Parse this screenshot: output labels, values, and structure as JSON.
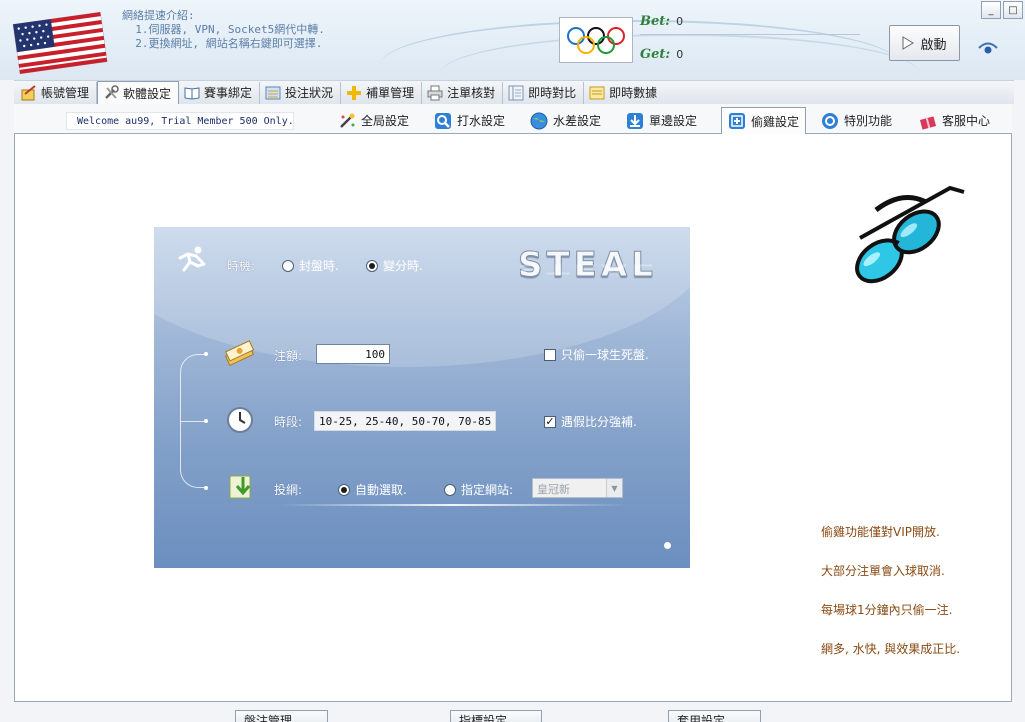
{
  "header": {
    "intro_lines": [
      "網絡提速介紹:",
      "  1.伺服器, VPN, Socket5網代中轉.",
      "  2.更換網址, 網站名稱右鍵即可選擇."
    ],
    "bet_label": "Bet:",
    "bet_value": "0",
    "get_label": "Get:",
    "get_value": "0",
    "start_label": "啟動",
    "minimize_label": "_",
    "close_label": "□"
  },
  "main_tabs": [
    {
      "label": "帳號管理",
      "icon": "account-icon"
    },
    {
      "label": "軟體設定",
      "icon": "tools-icon"
    },
    {
      "label": "賽事綁定",
      "icon": "book-icon"
    },
    {
      "label": "投注狀況",
      "icon": "list-icon"
    },
    {
      "label": "補單管理",
      "icon": "plus-icon"
    },
    {
      "label": "注單核對",
      "icon": "printer-icon"
    },
    {
      "label": "即時對比",
      "icon": "compare-icon"
    },
    {
      "label": "即時數據",
      "icon": "data-icon"
    }
  ],
  "welcome": "Welcome au99, Trial Member 500 Only.",
  "sub_tabs": [
    {
      "label": "全局設定",
      "icon": "wand-icon"
    },
    {
      "label": "打水設定",
      "icon": "magnifier-icon"
    },
    {
      "label": "水差設定",
      "icon": "globe-icon"
    },
    {
      "label": "單邊設定",
      "icon": "download-icon"
    },
    {
      "label": "偷雞設定",
      "icon": "plus-box-icon"
    },
    {
      "label": "特別功能",
      "icon": "target-icon"
    },
    {
      "label": "客服中心",
      "icon": "gift-icon"
    }
  ],
  "steal": {
    "logo": "STEAL",
    "timing_label": "時機:",
    "timing_opt1": "封盤時.",
    "timing_opt2": "變分時.",
    "amount_label": "注額:",
    "amount_value": "100",
    "period_label": "時段:",
    "period_value": "10-25, 25-40, 50-70, 70-85",
    "site_label": "投網:",
    "auto_label": "自動選取.",
    "specify_label": "指定網站:",
    "site_select": "皇冠新",
    "chk1_label": "只偷一球生死盤.",
    "chk1_checked": false,
    "chk2_label": "遇假比分強補.",
    "chk2_checked": true
  },
  "notes": [
    "偷雞功能僅對VIP開放.",
    "大部分注單會入球取消.",
    "每場球1分鐘內只偷一注.",
    "網多, 水快, 與效果成正比."
  ],
  "bottom_buttons": [
    "盤注管理",
    "指標設定",
    "套用設定"
  ],
  "colors": {
    "panel_top": "#c3d4e9",
    "panel_bottom": "#6c8fc0",
    "note_text": "#8a4a12",
    "bet_green": "#2f7f3a"
  }
}
